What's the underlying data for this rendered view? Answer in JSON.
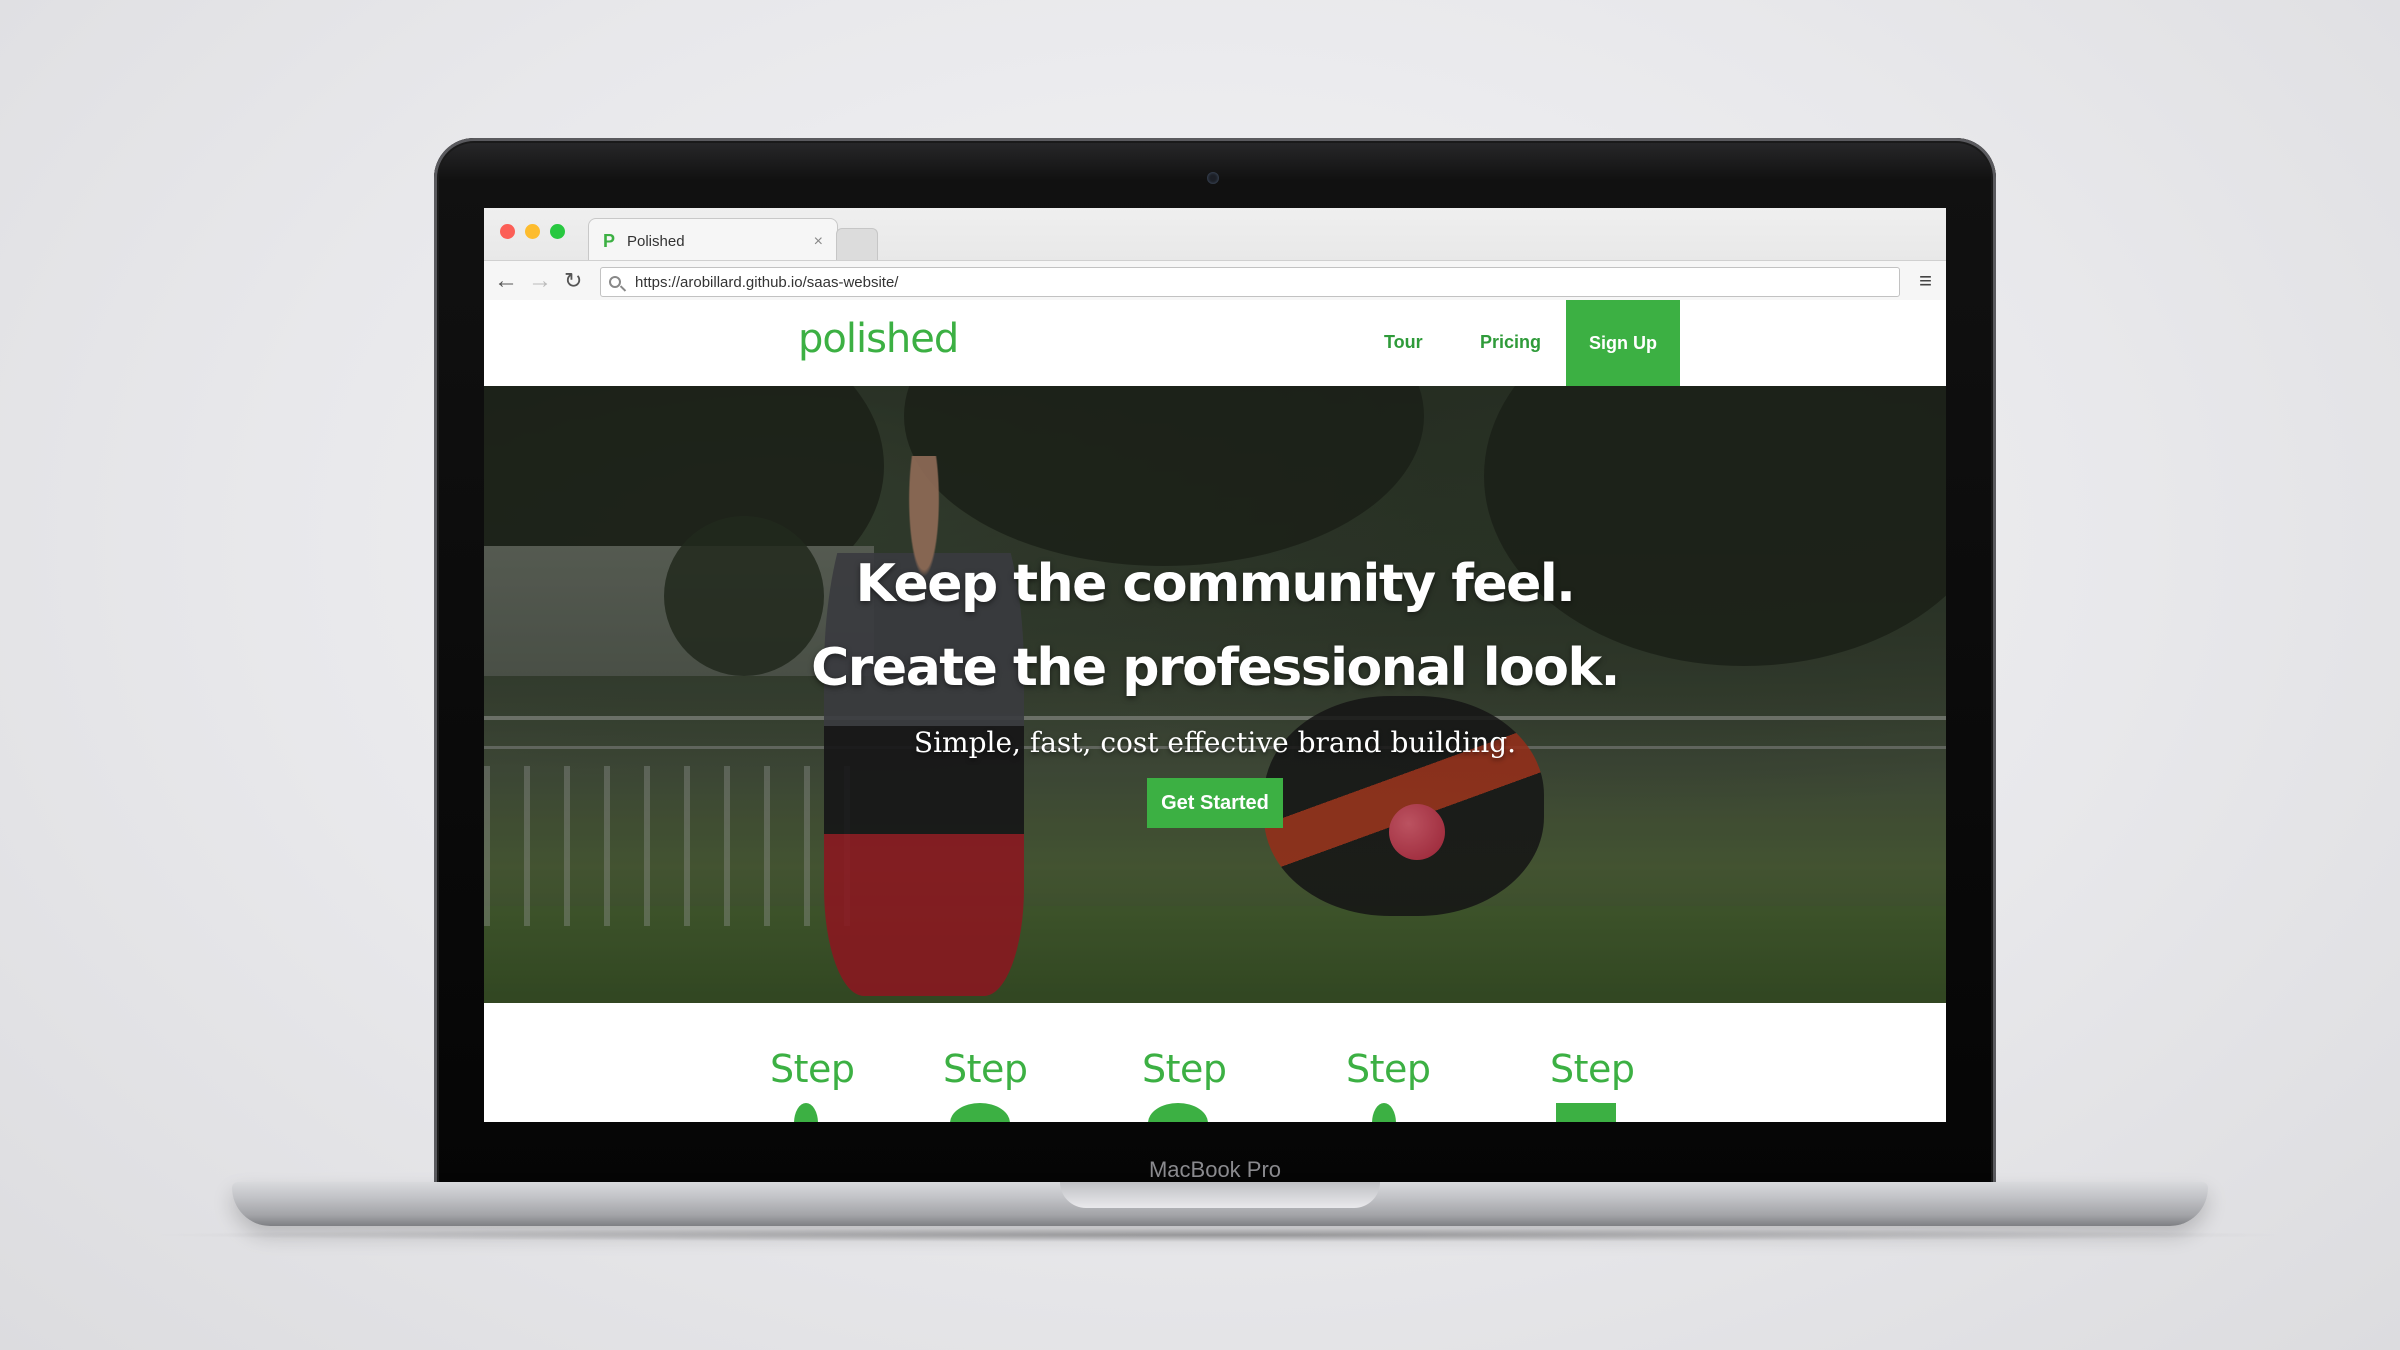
{
  "device": {
    "model_label": "MacBook Pro"
  },
  "browser": {
    "tab": {
      "favicon": "P",
      "title": "Polished",
      "close": "×"
    },
    "toolbar": {
      "back": "←",
      "forward": "→",
      "reload": "↻",
      "url": "https://arobillard.github.io/saas-website/",
      "menu": "≡"
    }
  },
  "site": {
    "logo": "polished",
    "nav": {
      "tour": "Tour",
      "pricing": "Pricing",
      "signup": "Sign Up"
    },
    "hero": {
      "line1": "Keep the community feel.",
      "line2": "Create the professional look.",
      "subtitle": "Simple, fast, cost effective brand building.",
      "cta": "Get Started"
    },
    "steps": [
      "Step",
      "Step",
      "Step",
      "Step",
      "Step"
    ]
  },
  "colors": {
    "brand_green": "#3cb043",
    "nav_link_green": "#2f9b3a"
  }
}
